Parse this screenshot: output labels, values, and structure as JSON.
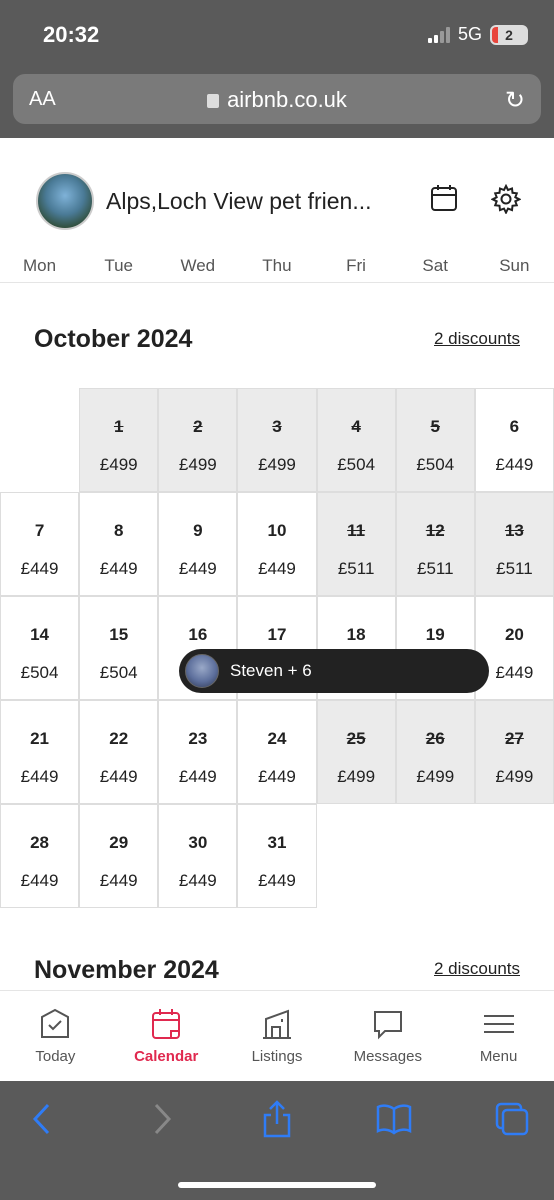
{
  "status": {
    "time": "20:32",
    "network": "5G",
    "battery": "2"
  },
  "browser": {
    "text_size": "AA",
    "url": "airbnb.co.uk"
  },
  "listing": {
    "title": "Alps,Loch View pet frien..."
  },
  "weekdays": [
    "Mon",
    "Tue",
    "Wed",
    "Thu",
    "Fri",
    "Sat",
    "Sun"
  ],
  "october": {
    "title": "October 2024",
    "discounts": "2 discounts",
    "days": [
      {
        "day": "1",
        "price": "£499",
        "booked": true
      },
      {
        "day": "2",
        "price": "£499",
        "booked": true
      },
      {
        "day": "3",
        "price": "£499",
        "booked": true
      },
      {
        "day": "4",
        "price": "£504",
        "booked": true
      },
      {
        "day": "5",
        "price": "£504",
        "booked": true
      },
      {
        "day": "6",
        "price": "£449",
        "booked": false
      },
      {
        "day": "7",
        "price": "£449",
        "booked": false
      },
      {
        "day": "8",
        "price": "£449",
        "booked": false
      },
      {
        "day": "9",
        "price": "£449",
        "booked": false
      },
      {
        "day": "10",
        "price": "£449",
        "booked": false
      },
      {
        "day": "11",
        "price": "£511",
        "booked": true
      },
      {
        "day": "12",
        "price": "£511",
        "booked": true
      },
      {
        "day": "13",
        "price": "£511",
        "booked": true
      },
      {
        "day": "14",
        "price": "£504",
        "booked": false
      },
      {
        "day": "15",
        "price": "£504",
        "booked": false
      },
      {
        "day": "16",
        "price": "",
        "booked": false
      },
      {
        "day": "17",
        "price": "",
        "booked": false
      },
      {
        "day": "18",
        "price": "",
        "booked": false
      },
      {
        "day": "19",
        "price": "",
        "booked": false
      },
      {
        "day": "20",
        "price": "£449",
        "booked": false
      },
      {
        "day": "21",
        "price": "£449",
        "booked": false
      },
      {
        "day": "22",
        "price": "£449",
        "booked": false
      },
      {
        "day": "23",
        "price": "£449",
        "booked": false
      },
      {
        "day": "24",
        "price": "£449",
        "booked": false
      },
      {
        "day": "25",
        "price": "£499",
        "booked": true
      },
      {
        "day": "26",
        "price": "£499",
        "booked": true
      },
      {
        "day": "27",
        "price": "£499",
        "booked": true
      },
      {
        "day": "28",
        "price": "£449",
        "booked": false
      },
      {
        "day": "29",
        "price": "£449",
        "booked": false
      },
      {
        "day": "30",
        "price": "£449",
        "booked": false
      },
      {
        "day": "31",
        "price": "£449",
        "booked": false
      }
    ]
  },
  "booking": {
    "label": "Steven + 6"
  },
  "november": {
    "title": "November 2024",
    "discounts": "2 discounts"
  },
  "tabs": [
    {
      "label": "Today",
      "icon": "today-icon",
      "active": false
    },
    {
      "label": "Calendar",
      "icon": "calendar-icon",
      "active": true
    },
    {
      "label": "Listings",
      "icon": "listings-icon",
      "active": false
    },
    {
      "label": "Messages",
      "icon": "messages-icon",
      "active": false
    },
    {
      "label": "Menu",
      "icon": "menu-icon",
      "active": false
    }
  ],
  "colors": {
    "accent": "#e0294f",
    "booked_bg": "#ebebeb",
    "chrome": "#5a5a5a",
    "safari_blue": "#2f7cf6"
  }
}
